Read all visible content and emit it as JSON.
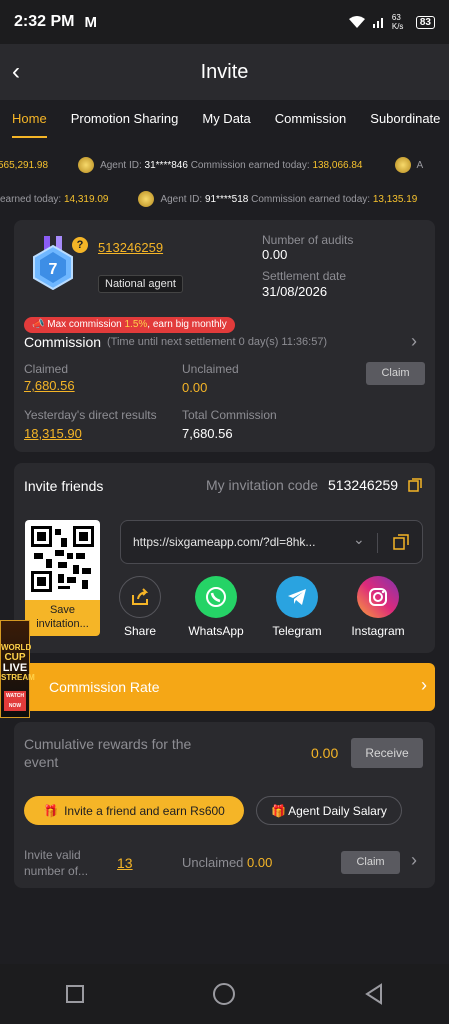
{
  "status": {
    "time": "2:32 PM",
    "mail_icon": "M",
    "net_speed": "63 K/s",
    "battery": "83"
  },
  "header": {
    "title": "Invite"
  },
  "tabs": [
    "Home",
    "Promotion Sharing",
    "My Data",
    "Commission",
    "Subordinate"
  ],
  "ticker1": {
    "lead_value": "565,291.98",
    "agent_label": "Agent ID:",
    "agent_id": "31****846",
    "earned_label": "Commission earned today:",
    "earned_value": "138,066.84",
    "tail": "A"
  },
  "ticker2": {
    "lead_label": "earned today:",
    "lead_value": "14,319.09",
    "agent_label": "Agent ID:",
    "agent_id": "91****518",
    "earned_label": "Commission earned today:",
    "earned_value": "13,135.19"
  },
  "agent": {
    "level": "7",
    "id": "513246259",
    "type": "National agent",
    "audits_label": "Number of audits",
    "audits_value": "0.00",
    "settlement_label": "Settlement date",
    "settlement_value": "31/08/2026"
  },
  "commission": {
    "max_prefix": "Max commission",
    "max_rate": "1.5%",
    "max_suffix": ", earn big monthly",
    "title": "Commission",
    "subtitle": "(Time until next settlement  0 day(s) 11:36:57)",
    "claimed_label": "Claimed",
    "claimed_value": "7,680.56",
    "unclaimed_label": "Unclaimed",
    "unclaimed_value": "0.00",
    "claim_button": "Claim",
    "yesterday_label": "Yesterday's direct results",
    "yesterday_value": "18,315.90",
    "total_label": "Total Commission",
    "total_value": "7,680.56"
  },
  "invite": {
    "title": "Invite friends",
    "code_label": "My invitation code",
    "code_value": "513246259",
    "save_label": "Save invitation...",
    "link": "https://sixgameapp.com/?dl=8hk...",
    "share": [
      {
        "label": "Share",
        "icon": "share-icon",
        "color": "#2a2a2e"
      },
      {
        "label": "WhatsApp",
        "icon": "whatsapp-icon",
        "color": "#25d366"
      },
      {
        "label": "Telegram",
        "icon": "telegram-icon",
        "color": "#2aa3e0"
      },
      {
        "label": "Instagram",
        "icon": "instagram-icon",
        "color": "#dd2a7b"
      }
    ]
  },
  "promo": {
    "line1": "WORLD",
    "line2": "CUP",
    "line3": "LIVE",
    "line4": "STREAM",
    "line5": "WATCH NOW"
  },
  "rate": {
    "label": "Commission Rate"
  },
  "event": {
    "cumulative_label": "Cumulative rewards for the event",
    "cumulative_value": "0.00",
    "receive_button": "Receive",
    "invite_pill": "Invite a friend and earn Rs600",
    "salary_pill": "Agent Daily Salary",
    "valid_label": "Invite valid number of...",
    "valid_value": "13",
    "unclaimed_label": "Unclaimed",
    "unclaimed_value": "0.00",
    "claim_button": "Claim"
  },
  "colors": {
    "accent": "#f5b527",
    "bg": "#1e1e22",
    "card": "#2a2a2e",
    "danger": "#e23b3b"
  }
}
